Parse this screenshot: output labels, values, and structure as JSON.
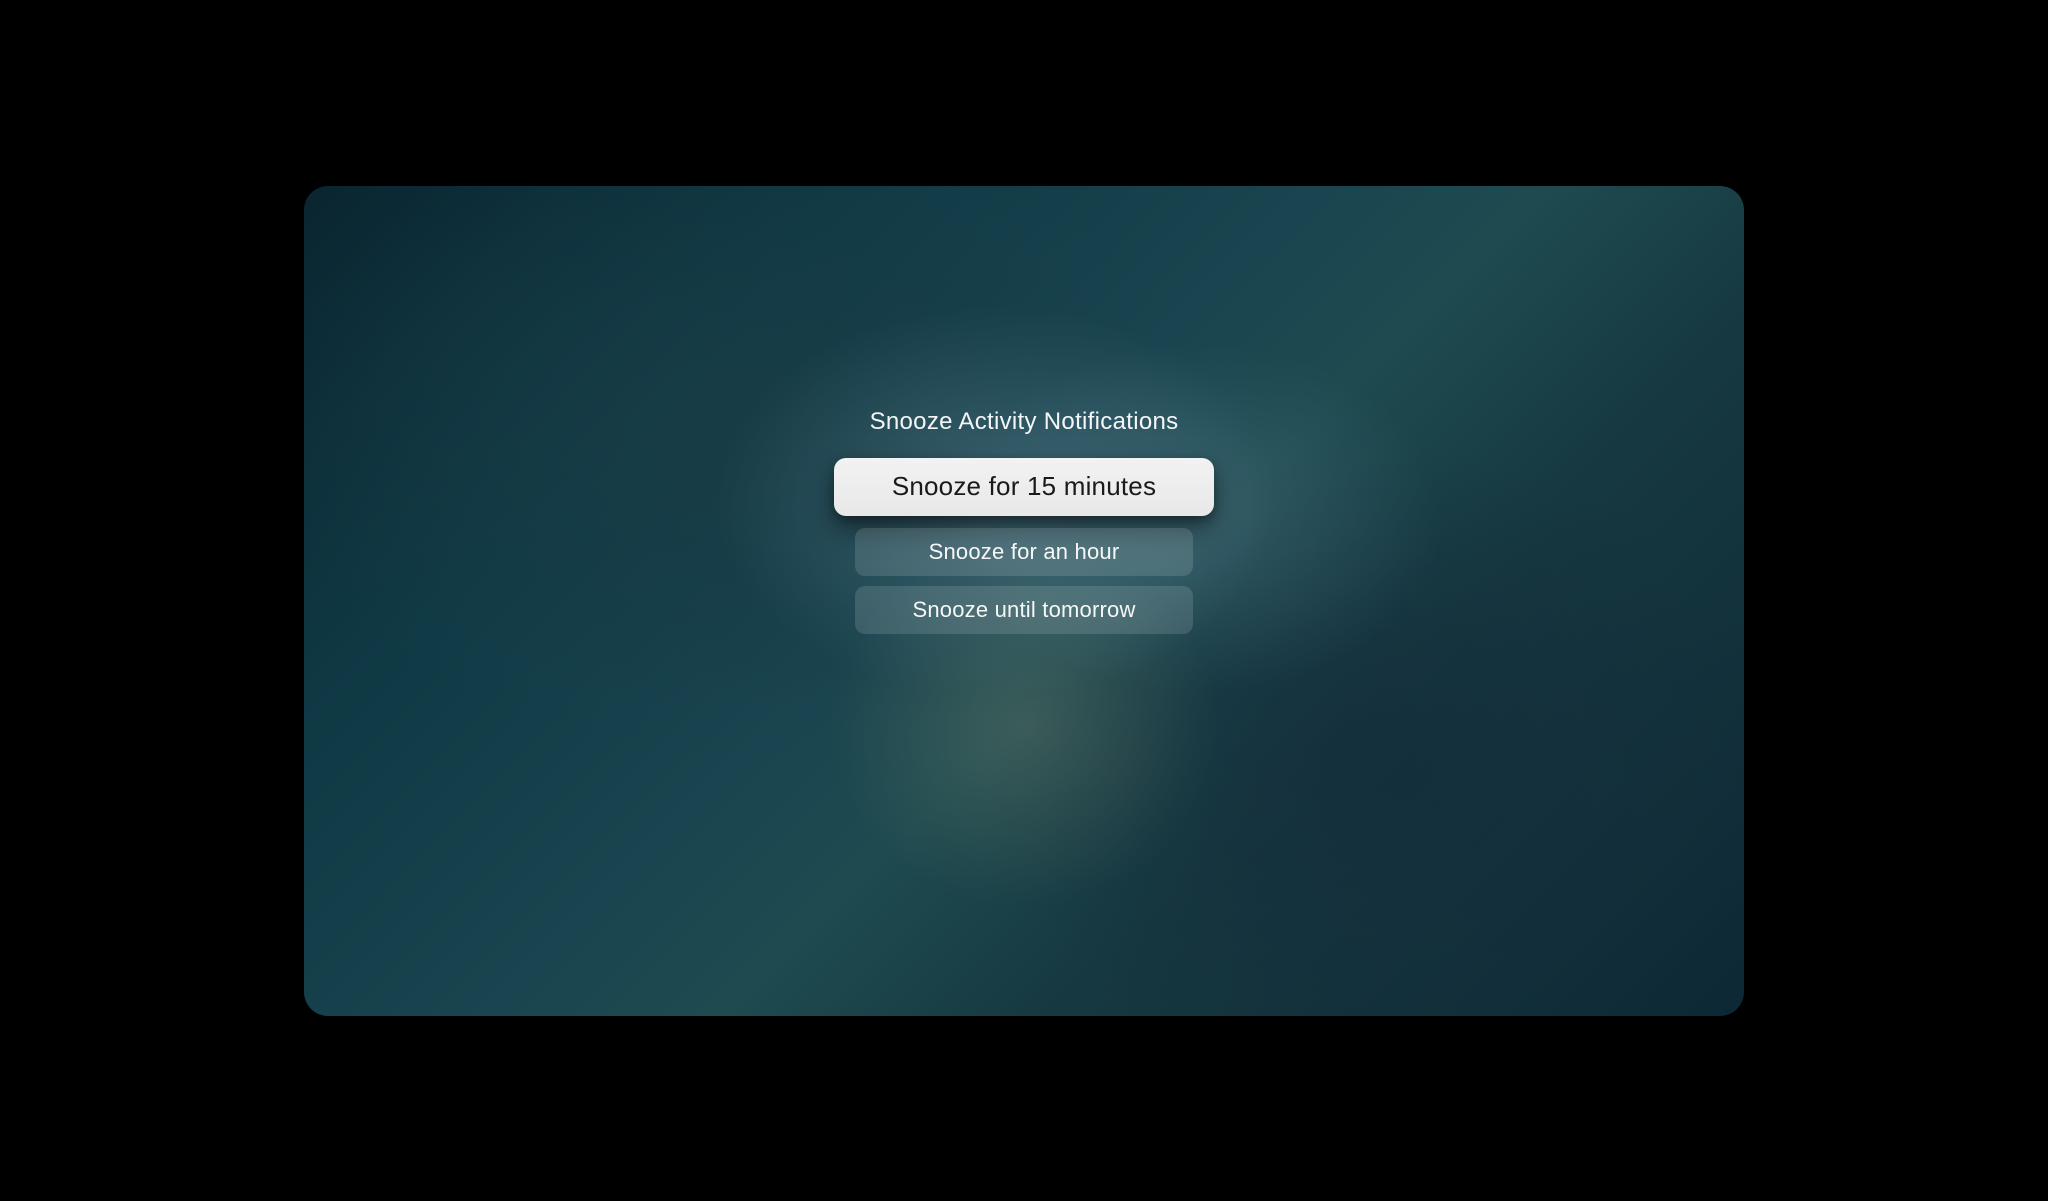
{
  "dialog": {
    "title": "Snooze Activity Notifications",
    "options": [
      {
        "label": "Snooze for 15 minutes",
        "focused": true
      },
      {
        "label": "Snooze for an hour",
        "focused": false
      },
      {
        "label": "Snooze until tomorrow",
        "focused": false
      }
    ]
  }
}
